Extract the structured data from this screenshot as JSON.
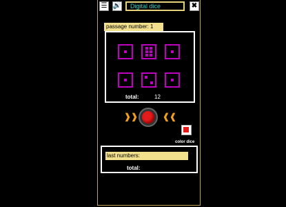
{
  "app": {
    "title": "Digital dice",
    "menu_icon": "menu-icon",
    "sound_icon": "speaker-icon",
    "close_icon": "close-icon"
  },
  "passage": {
    "label": "passage number: 1"
  },
  "dice": [
    {
      "value": 1
    },
    {
      "value": 6
    },
    {
      "value": 1
    },
    {
      "value": 1
    },
    {
      "value": 2
    },
    {
      "value": 1
    }
  ],
  "total": {
    "label": "total:",
    "value": "12"
  },
  "roll": {
    "icon": "red-roll-button",
    "left_arrow": "chevron-right-icon",
    "right_arrow": "chevron-left-icon"
  },
  "color_dice": {
    "label": "color dice",
    "icon": "color-dice-icon"
  },
  "last": {
    "label": "last numbers:",
    "total_label": "total:"
  },
  "colors": {
    "die": "#c000c0",
    "accent": "#f2e08d",
    "title": "#2bd3c7",
    "roll": "#e31b1b"
  }
}
